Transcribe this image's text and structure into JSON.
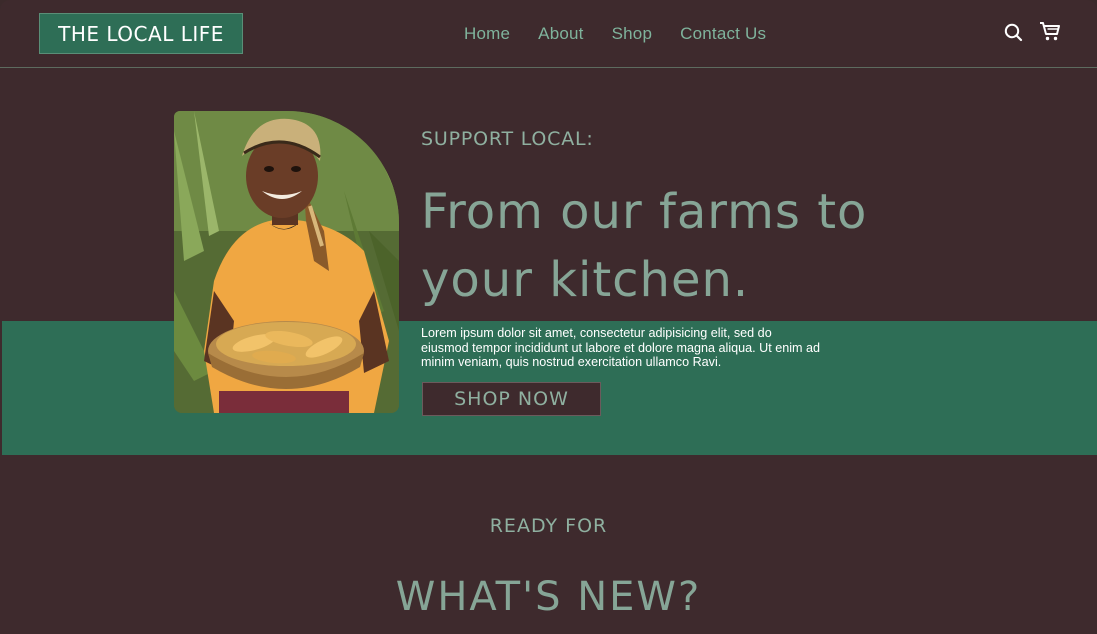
{
  "brand": {
    "logo_text": "THE LOCAL LIFE"
  },
  "nav": {
    "items": [
      "Home",
      "About",
      "Shop",
      "Contact Us"
    ]
  },
  "header_icons": [
    "search-icon",
    "cart-icon"
  ],
  "hero": {
    "eyebrow": "SUPPORT LOCAL:",
    "headline": "From our farms to your kitchen.",
    "body": "Lorem ipsum dolor sit amet, consectetur adipisicing elit, sed do eiusmod tempor incididunt ut labore et dolore magna aliqua. Ut enim ad minim veniam, quis nostrud exercitation ullamco Ravi.",
    "cta_label": "SHOP NOW"
  },
  "section": {
    "kicker": "READY FOR",
    "title": "WHAT'S NEW?"
  },
  "colors": {
    "background": "#3e2a2d",
    "green": "#2e6e56",
    "sage": "#86a596",
    "text_light": "#ffffff"
  }
}
